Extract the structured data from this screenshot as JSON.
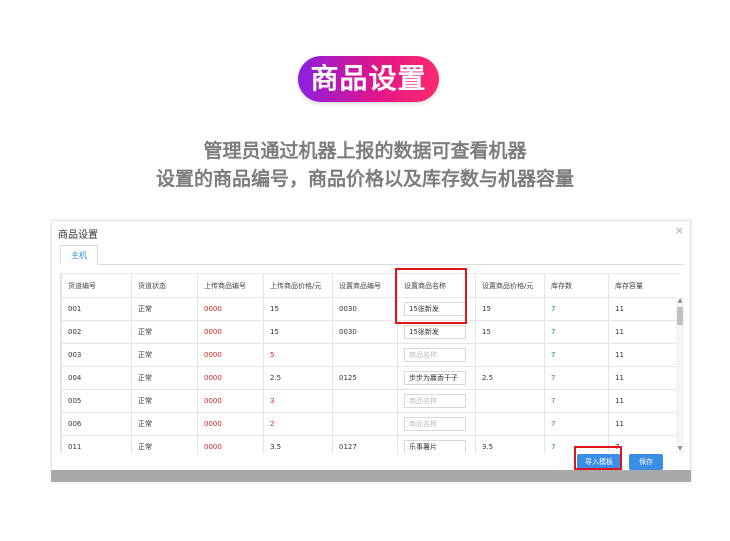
{
  "hero": {
    "title": "商品设置",
    "line1": "管理员通过机器上报的数据可查看机器",
    "line2": "设置的商品编号，商品价格以及库存数与机器容量"
  },
  "panel": {
    "title": "商品设置",
    "close_icon": "×",
    "tab": "主机"
  },
  "table": {
    "headers": [
      "货道编号",
      "货道状态",
      "上传商品编号",
      "上传商品价格/元",
      "设置商品编号",
      "设置商品名称",
      "设置商品价格/元",
      "库存数",
      "库存容量"
    ],
    "rows": [
      {
        "lane": "001",
        "status": "正常",
        "up_code": "0000",
        "up_price": "15",
        "set_code": "0030",
        "name": "15张新发",
        "name_placeholder": false,
        "set_price": "15",
        "stock": "7",
        "capacity": "11"
      },
      {
        "lane": "002",
        "status": "正常",
        "up_code": "0000",
        "up_price": "15",
        "set_code": "0030",
        "name": "15张新发",
        "name_placeholder": false,
        "set_price": "15",
        "stock": "7",
        "capacity": "11"
      },
      {
        "lane": "003",
        "status": "正常",
        "up_code": "0000",
        "up_price": "5",
        "set_code": "",
        "name": "商品名称",
        "name_placeholder": true,
        "set_price": "",
        "stock": "7",
        "capacity": "11"
      },
      {
        "lane": "004",
        "status": "正常",
        "up_code": "0000",
        "up_price": "2.5",
        "set_code": "0125",
        "name": "步步为赢香干子",
        "name_placeholder": false,
        "set_price": "2.5",
        "stock": "7",
        "capacity": "11"
      },
      {
        "lane": "005",
        "status": "正常",
        "up_code": "0000",
        "up_price": "3",
        "set_code": "",
        "name": "商品名称",
        "name_placeholder": true,
        "set_price": "",
        "stock": "7",
        "capacity": "11"
      },
      {
        "lane": "006",
        "status": "正常",
        "up_code": "0000",
        "up_price": "2",
        "set_code": "",
        "name": "商品名称",
        "name_placeholder": true,
        "set_price": "",
        "stock": "7",
        "capacity": "11"
      },
      {
        "lane": "011",
        "status": "正常",
        "up_code": "0000",
        "up_price": "3.5",
        "set_code": "0127",
        "name": "乐事薯片",
        "name_placeholder": false,
        "set_price": "3.5",
        "stock": "7",
        "capacity": "7"
      }
    ]
  },
  "buttons": {
    "import_label": "导入模板",
    "save_label": "保存"
  },
  "colors": {
    "accent": "#3a8ee6",
    "highlight": "#e0141e",
    "code_red": "#e02020",
    "stock_green": "#1aa11a"
  }
}
